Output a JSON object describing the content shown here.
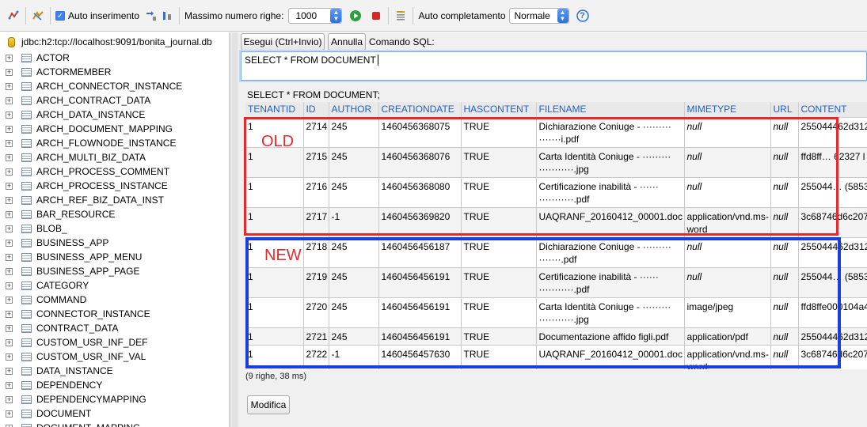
{
  "toolbar": {
    "auto_insert_label": "Auto inserimento",
    "max_rows_label": "Massimo numero righe:",
    "max_rows_value": "1000",
    "autocomplete_label": "Auto completamento",
    "autocomplete_value": "Normale",
    "help_glyph": "?"
  },
  "sidebar": {
    "connection": "jdbc:h2:tcp://localhost:9091/bonita_journal.db",
    "tables": [
      "ACTOR",
      "ACTORMEMBER",
      "ARCH_CONNECTOR_INSTANCE",
      "ARCH_CONTRACT_DATA",
      "ARCH_DATA_INSTANCE",
      "ARCH_DOCUMENT_MAPPING",
      "ARCH_FLOWNODE_INSTANCE",
      "ARCH_MULTI_BIZ_DATA",
      "ARCH_PROCESS_COMMENT",
      "ARCH_PROCESS_INSTANCE",
      "ARCH_REF_BIZ_DATA_INST",
      "BAR_RESOURCE",
      "BLOB_",
      "BUSINESS_APP",
      "BUSINESS_APP_MENU",
      "BUSINESS_APP_PAGE",
      "CATEGORY",
      "COMMAND",
      "CONNECTOR_INSTANCE",
      "CONTRACT_DATA",
      "CUSTOM_USR_INF_DEF",
      "CUSTOM_USR_INF_VAL",
      "DATA_INSTANCE",
      "DEPENDENCY",
      "DEPENDENCYMAPPING",
      "DOCUMENT",
      "DOCUMENT_MAPPING"
    ]
  },
  "editor": {
    "execute_label": "Esegui (Ctrl+Invio)",
    "cancel_label": "Annulla",
    "sql_label": "Comando SQL:",
    "sql_text": "SELECT * FROM DOCUMENT",
    "result_query": "SELECT * FROM DOCUMENT;"
  },
  "results": {
    "columns": [
      "TENANTID",
      "ID",
      "AUTHOR",
      "CREATIONDATE",
      "HASCONTENT",
      "FILENAME",
      "MIMETYPE",
      "URL",
      "CONTENT"
    ],
    "rows": [
      [
        "1",
        "2714",
        "245",
        "1460456368075",
        "TRUE",
        "Dichiarazione Coniuge - ·········  ·······i.pdf",
        "null",
        "null",
        "255044462d312"
      ],
      [
        "1",
        "2715",
        "245",
        "1460456368076",
        "TRUE",
        "Carta Identità Coniuge - ·········  ···········.jpg",
        "null",
        "null",
        "ffd8ff… 62327 l"
      ],
      [
        "1",
        "2716",
        "245",
        "1460456368080",
        "TRUE",
        "Certificazione inabilità - ······  ···········.pdf",
        "null",
        "null",
        "255044… (5853"
      ],
      [
        "1",
        "2717",
        "-1",
        "1460456369820",
        "TRUE",
        "UAQRANF_20160412_00001.doc",
        "application/vnd.ms-word",
        "null",
        "3c68746d6c207"
      ],
      [
        "1",
        "2718",
        "245",
        "1460456456187",
        "TRUE",
        "Dichiarazione Coniuge - ·········  ·······.pdf",
        "null",
        "null",
        "255044462d312"
      ],
      [
        "1",
        "2719",
        "245",
        "1460456456191",
        "TRUE",
        "Certificazione inabilità - ······  ···········.pdf",
        "null",
        "null",
        "255044… (5853"
      ],
      [
        "1",
        "2720",
        "245",
        "1460456456191",
        "TRUE",
        "Carta Identità Coniuge - ·········  ···········.jpg",
        "image/jpeg",
        "null",
        "ffd8ffe000104a4"
      ],
      [
        "1",
        "2721",
        "245",
        "1460456456191",
        "TRUE",
        "Documentazione affido figli.pdf",
        "application/pdf",
        "null",
        "255044462d312"
      ],
      [
        "1",
        "2722",
        "-1",
        "1460456457630",
        "TRUE",
        "UAQRANF_20160412_00001.doc",
        "application/vnd.ms-word",
        "null",
        "3c68746d6c207"
      ]
    ],
    "status": "(9 righe, 38 ms)",
    "edit_label": "Modifica"
  },
  "annotations": {
    "old_label": "OLD",
    "new_label": "NEW",
    "old_color": "#e8282a",
    "new_color": "#1a3ee0"
  }
}
